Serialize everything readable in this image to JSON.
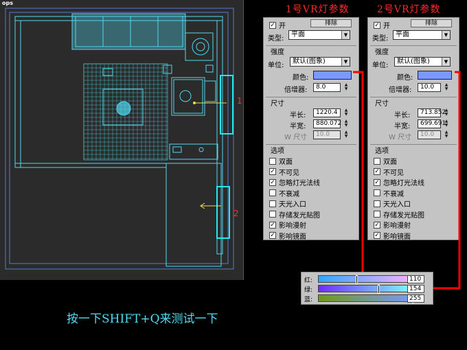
{
  "viewport": {
    "label": "ops"
  },
  "annotations": {
    "light1_marker": "1",
    "light2_marker": "2"
  },
  "caption": "按一下SHIFT+Q来测试一下",
  "colors": {
    "accent": "#ff0000",
    "wire": "#4fd8ef",
    "swatch": "#7a98ff"
  },
  "panels": [
    {
      "title": "1号VR灯参数",
      "toggle_label": "开",
      "exclude_label": "排除",
      "type_label": "类型:",
      "type_value": "平面",
      "intensity_group": "强度",
      "unit_label": "单位:",
      "unit_value": "默认(图象)",
      "color_label": "颜色:",
      "multiplier_label": "倍增器:",
      "multiplier_value": "8.0",
      "size_group": "尺寸",
      "half_length_label": "半长:",
      "half_length_value": "1220.4",
      "half_width_label": "半宽:",
      "half_width_value": "880.072",
      "w_size_label": "W 尺寸",
      "w_size_value": "10.0",
      "options_group": "选项",
      "options": [
        {
          "label": "双面",
          "checked": false
        },
        {
          "label": "不可见",
          "checked": true
        },
        {
          "label": "忽略灯光法线",
          "checked": true
        },
        {
          "label": "不衰减",
          "checked": false
        },
        {
          "label": "天光入口",
          "checked": false
        },
        {
          "label": "存储发光贴图",
          "checked": false
        },
        {
          "label": "影响漫射",
          "checked": true
        },
        {
          "label": "影响镜面",
          "checked": true
        }
      ]
    },
    {
      "title": "2号VR灯参数",
      "toggle_label": "开",
      "exclude_label": "排除",
      "type_label": "类型:",
      "type_value": "平面",
      "intensity_group": "强度",
      "unit_label": "单位:",
      "unit_value": "默认(图象)",
      "color_label": "颜色:",
      "multiplier_label": "倍增器:",
      "multiplier_value": "10.0",
      "size_group": "尺寸",
      "half_length_label": "半长:",
      "half_length_value": "713.852",
      "half_width_label": "半宽:",
      "half_width_value": "699.691",
      "w_size_label": "W 尺寸",
      "w_size_value": "10.0",
      "options_group": "选项",
      "options": [
        {
          "label": "双面",
          "checked": false
        },
        {
          "label": "不可见",
          "checked": true
        },
        {
          "label": "忽略灯光法线",
          "checked": true
        },
        {
          "label": "不衰减",
          "checked": false
        },
        {
          "label": "天光入口",
          "checked": false
        },
        {
          "label": "存储发光贴图",
          "checked": false
        },
        {
          "label": "影响漫射",
          "checked": true
        },
        {
          "label": "影响镜面",
          "checked": true
        }
      ]
    }
  ],
  "color_picker": {
    "red_label": "红:",
    "red_value": "110",
    "green_label": "绿:",
    "green_value": "154",
    "blue_label": "蓝:",
    "blue_value": "255"
  }
}
